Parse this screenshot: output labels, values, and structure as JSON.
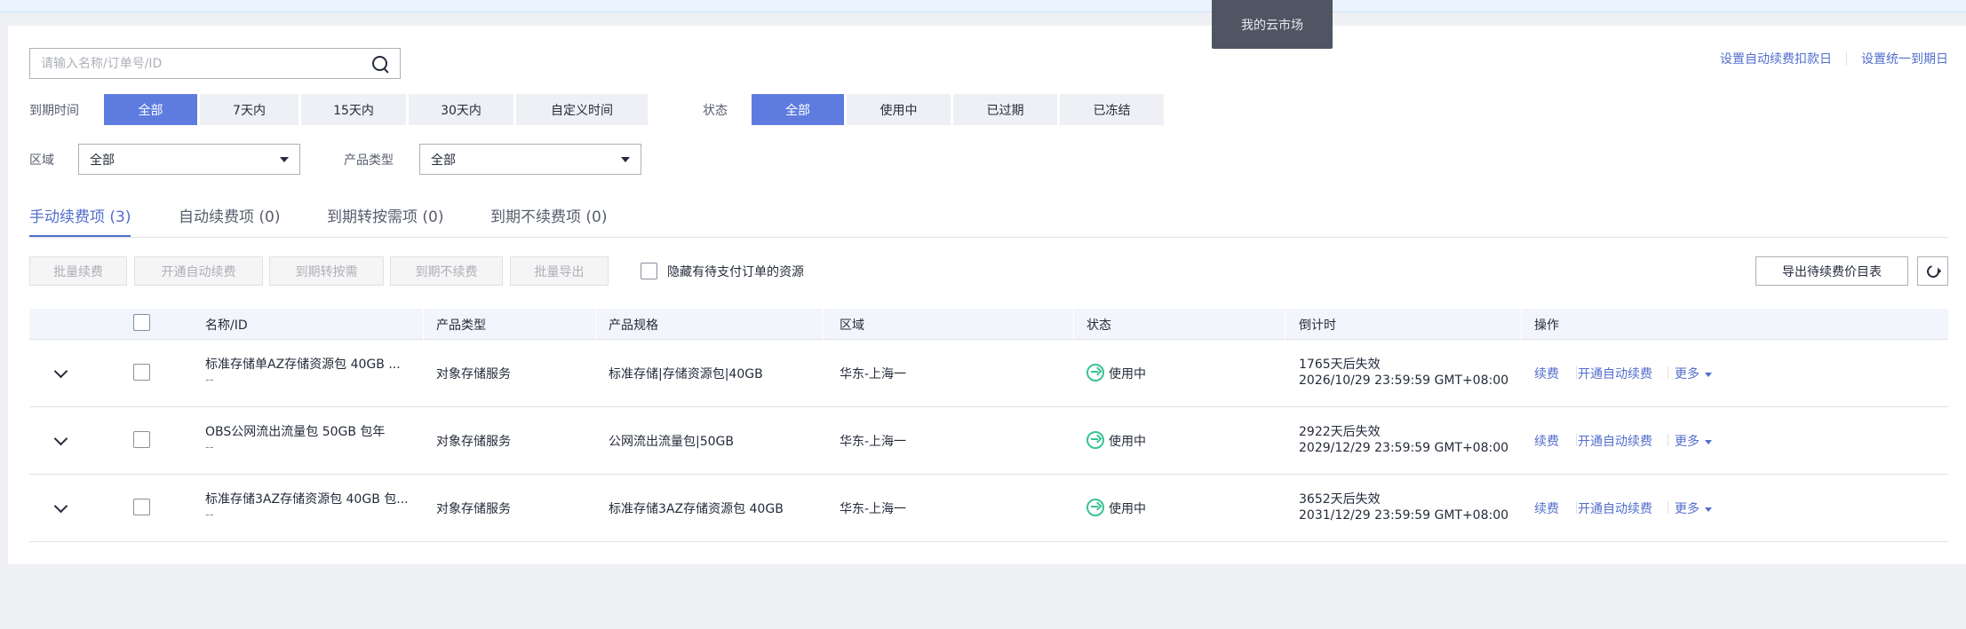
{
  "tooltip": {
    "text": "我的云市场"
  },
  "search": {
    "placeholder": "请输入名称/订单号/ID"
  },
  "top_links": {
    "auto_renew_date": "设置自动续费扣款日",
    "unified_expiry": "设置统一到期日"
  },
  "filters": {
    "expiry_label": "到期时间",
    "expiry_options": [
      "全部",
      "7天内",
      "15天内",
      "30天内",
      "自定义时间"
    ],
    "expiry_selected": "全部",
    "status_label": "状态",
    "status_options": [
      "全部",
      "使用中",
      "已过期",
      "已冻结"
    ],
    "status_selected": "全部",
    "region_label": "区域",
    "region_value": "全部",
    "product_type_label": "产品类型",
    "product_type_value": "全部"
  },
  "tabs": [
    {
      "label": "手动续费项 (3)",
      "active": true
    },
    {
      "label": "自动续费项 (0)",
      "active": false
    },
    {
      "label": "到期转按需项 (0)",
      "active": false
    },
    {
      "label": "到期不续费项 (0)",
      "active": false
    }
  ],
  "toolbar": {
    "batch_renew": "批量续费",
    "enable_auto_renew": "开通自动续费",
    "to_on_demand": "到期转按需",
    "no_renew": "到期不续费",
    "batch_export": "批量导出",
    "hide_pending": "隐藏有待支付订单的资源",
    "export_price_list": "导出待续费价目表"
  },
  "table": {
    "headers": [
      "名称/ID",
      "产品类型",
      "产品规格",
      "区域",
      "状态",
      "倒计时",
      "操作"
    ],
    "rows": [
      {
        "name": "标准存储单AZ存储资源包 40GB ...",
        "id": "--",
        "type": "对象存储服务",
        "spec": "标准存储|存储资源包|40GB",
        "region": "华东-上海一",
        "status": "使用中",
        "countdown": "1765天后失效",
        "expiry": "2026/10/29 23:59:59 GMT+08:00"
      },
      {
        "name": "OBS公网流出流量包 50GB 包年",
        "id": "--",
        "type": "对象存储服务",
        "spec": "公网流出流量包|50GB",
        "region": "华东-上海一",
        "status": "使用中",
        "countdown": "2922天后失效",
        "expiry": "2029/12/29 23:59:59 GMT+08:00"
      },
      {
        "name": "标准存储3AZ存储资源包 40GB 包...",
        "id": "--",
        "type": "对象存储服务",
        "spec": "标准存储3AZ存储资源包 40GB",
        "region": "华东-上海一",
        "status": "使用中",
        "countdown": "3652天后失效",
        "expiry": "2031/12/29 23:59:59 GMT+08:00"
      }
    ],
    "actions": {
      "renew": "续费",
      "auto_renew": "开通自动续费",
      "more": "更多"
    }
  }
}
